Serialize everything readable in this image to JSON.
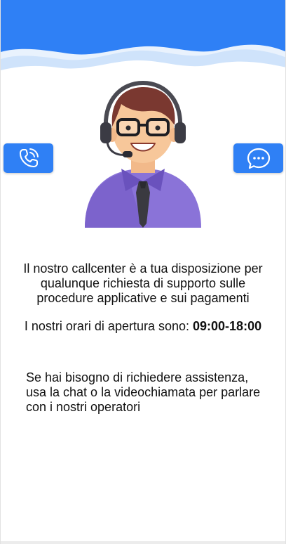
{
  "colors": {
    "primary": "#2f80f5",
    "wave_light": "#cfe3fb",
    "text": "#111111"
  },
  "icons": {
    "left_button": "phone-call-icon",
    "right_button": "chat-bubble-icon",
    "avatar": "call-center-operator-avatar"
  },
  "content": {
    "intro": "Il nostro callcenter è a tua disposizione per qualunque richiesta di supporto sulle procedure applicative e sui pagamenti",
    "hours_label": "I nostri orari di apertura sono: ",
    "hours_value": "09:00-18:00",
    "help": "Se hai bisogno di richiedere assistenza, usa la chat o la videochiamata per parlare con i nostri operatori"
  }
}
